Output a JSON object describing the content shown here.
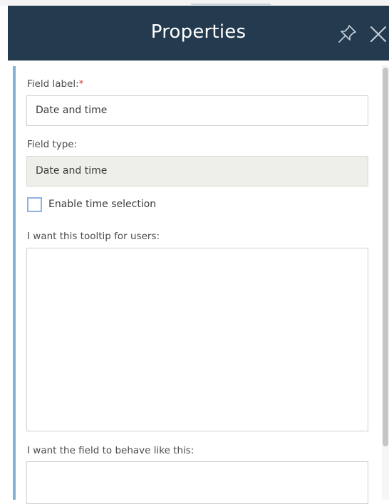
{
  "panel": {
    "title": "Properties",
    "pin_icon": "pin-icon",
    "close_icon": "close-icon",
    "header_color": "#243a4f",
    "accent_color": "#7fb2d6"
  },
  "form": {
    "field_label": {
      "label": "Field label:",
      "required_mark": "*",
      "value": "Date and time"
    },
    "field_type": {
      "label": "Field type:",
      "value": "Date and time"
    },
    "time_selection": {
      "label": "Enable time selection",
      "checked": false
    },
    "tooltip": {
      "label": "I want this tooltip for users:",
      "value": ""
    },
    "behavior": {
      "label": "I want the field to behave like this:",
      "value": ""
    }
  }
}
